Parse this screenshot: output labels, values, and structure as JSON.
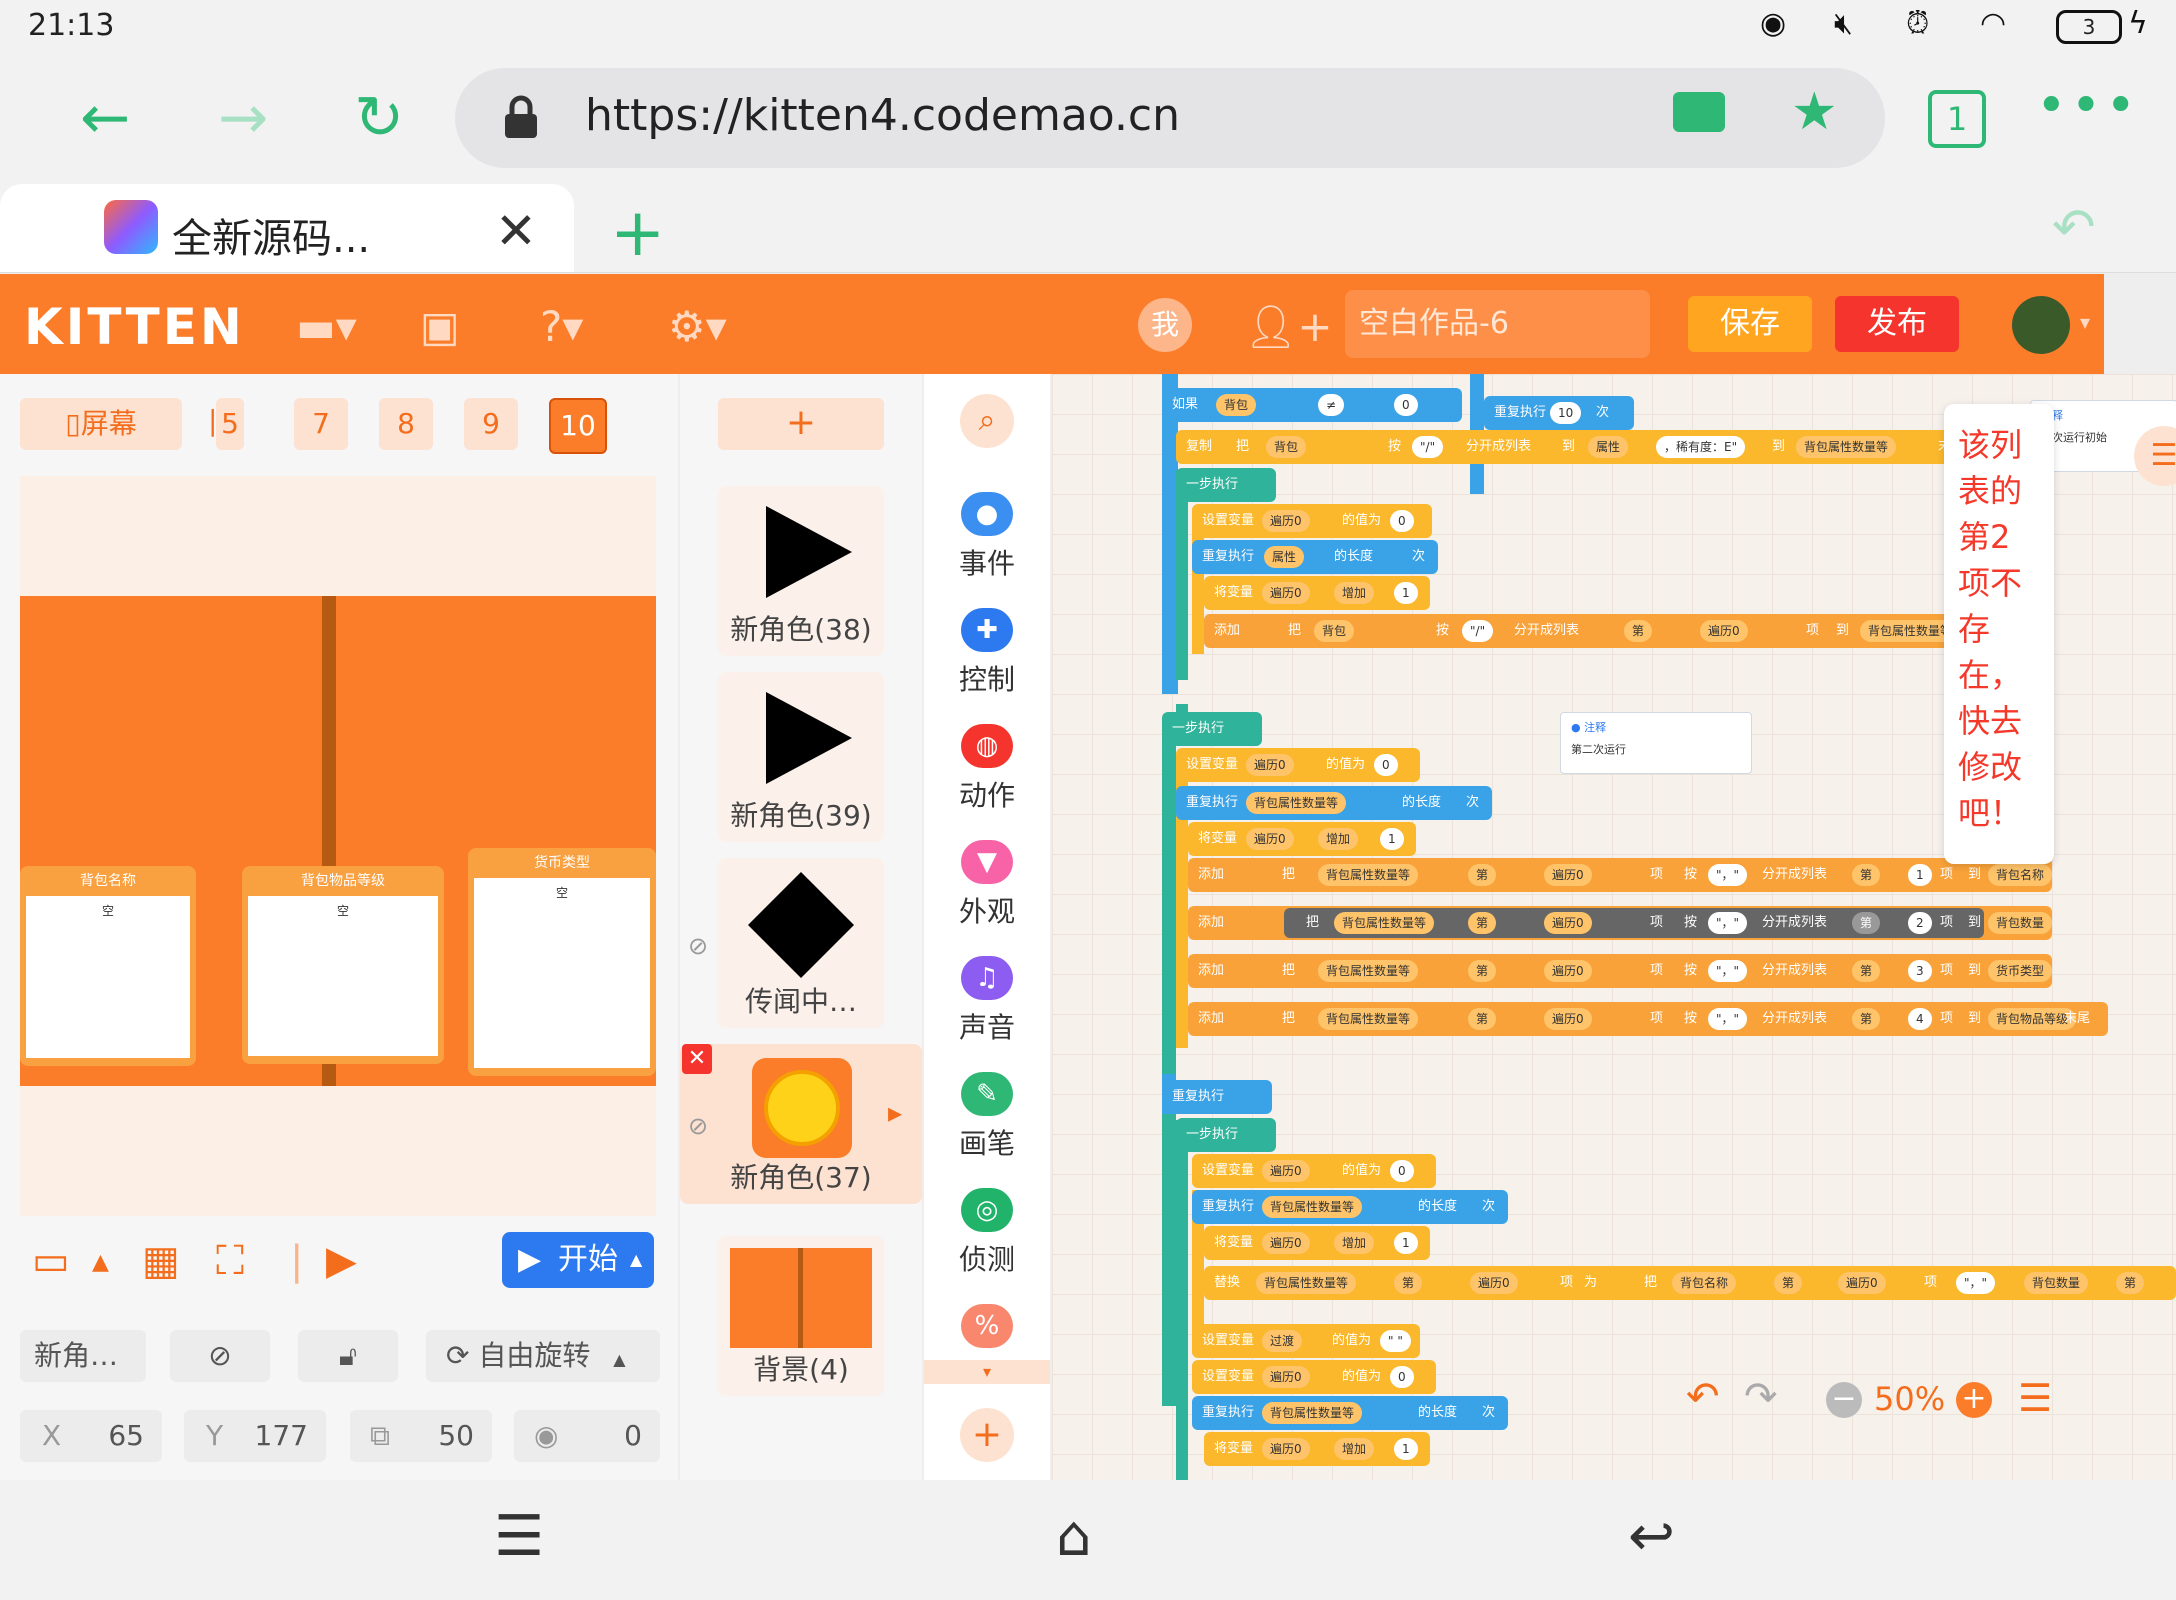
{
  "status": {
    "time": "21:13",
    "battery": "3"
  },
  "browser": {
    "url": "https://kitten4.codemao.cn",
    "tab_count": "1",
    "tab_title": "全新源码...",
    "accent": "#2fb875"
  },
  "header": {
    "logo": "KITTEN",
    "me_label": "我",
    "project_name_placeholder": "空白作品-6",
    "save_label": "保存",
    "publish_label": "发布",
    "brand_color": "#fb7d2a"
  },
  "stage": {
    "screen_label": "屏幕",
    "scene_tabs": [
      "5",
      "7",
      "8",
      "9",
      "10"
    ],
    "active_scene": "10",
    "list_cards": [
      {
        "title": "背包名称",
        "value": "空"
      },
      {
        "title": "背包物品等级",
        "value": "空"
      },
      {
        "title": "货币类型",
        "value": "空"
      }
    ],
    "start_label": "开始",
    "sprite_name": "新角…",
    "rotation_label": "自由旋转",
    "x_label": "X",
    "x_value": "65",
    "y_label": "Y",
    "y_value": "177",
    "size_value": "50",
    "direction_value": "0"
  },
  "sprites": {
    "add_label": "+",
    "items": [
      {
        "name": "新角色(38)"
      },
      {
        "name": "新角色(39)"
      },
      {
        "name": "传闻中…"
      },
      {
        "name": "新角色(37)"
      }
    ],
    "background_label": "背景(4)"
  },
  "categories": [
    {
      "label": "事件",
      "color": "#3a8ff0"
    },
    {
      "label": "控制",
      "color": "#2d79ef"
    },
    {
      "label": "动作",
      "color": "#f5352d"
    },
    {
      "label": "外观",
      "color": "#f763a6"
    },
    {
      "label": "声音",
      "color": "#8d5cf0"
    },
    {
      "label": "画笔",
      "color": "#2fb875"
    },
    {
      "label": "侦测",
      "color": "#22b36b"
    }
  ],
  "code": {
    "b_if": "如果",
    "b_bag": "背包",
    "b_neq": "≠",
    "b_zero": "0",
    "b_copy": "复制",
    "b_put": "把",
    "b_by": "按",
    "b_slash": "\"/\"",
    "b_split": "分开成列表",
    "b_to": "到",
    "b_attr": "属性",
    "b_rarity": "，稀有度：E\"",
    "b_list1": "背包属性数量等",
    "b_end": "末尾",
    "b_repeat": "重复执行",
    "b_ten": "10",
    "b_times": "次",
    "b_step": "一步执行",
    "b_setvar": "设置变量",
    "b_iter": "遍历0",
    "b_valis": "的值为",
    "b_length": "的长度",
    "b_changevar": "将变量",
    "b_inc": "增加",
    "b_one": "1",
    "b_add": "添加",
    "b_nth": "第",
    "b_item": "项",
    "b_comma": "\"，\"",
    "b_two": "2",
    "b_three": "3",
    "b_four": "4",
    "b_t1": "背包名称",
    "b_t2": "背包数量",
    "b_t3": "货币类型",
    "b_t4": "背包物品等级",
    "b_replace": "替换",
    "b_as": "为",
    "b_transit": "过渡",
    "b_empty": "\" \"",
    "comment_title": "注释",
    "comment_text": "第二次运行",
    "comment2_text": "一次运行初始",
    "tooltip": "该列表的第2项不存在，快去修改吧！",
    "zoom": "50%"
  }
}
